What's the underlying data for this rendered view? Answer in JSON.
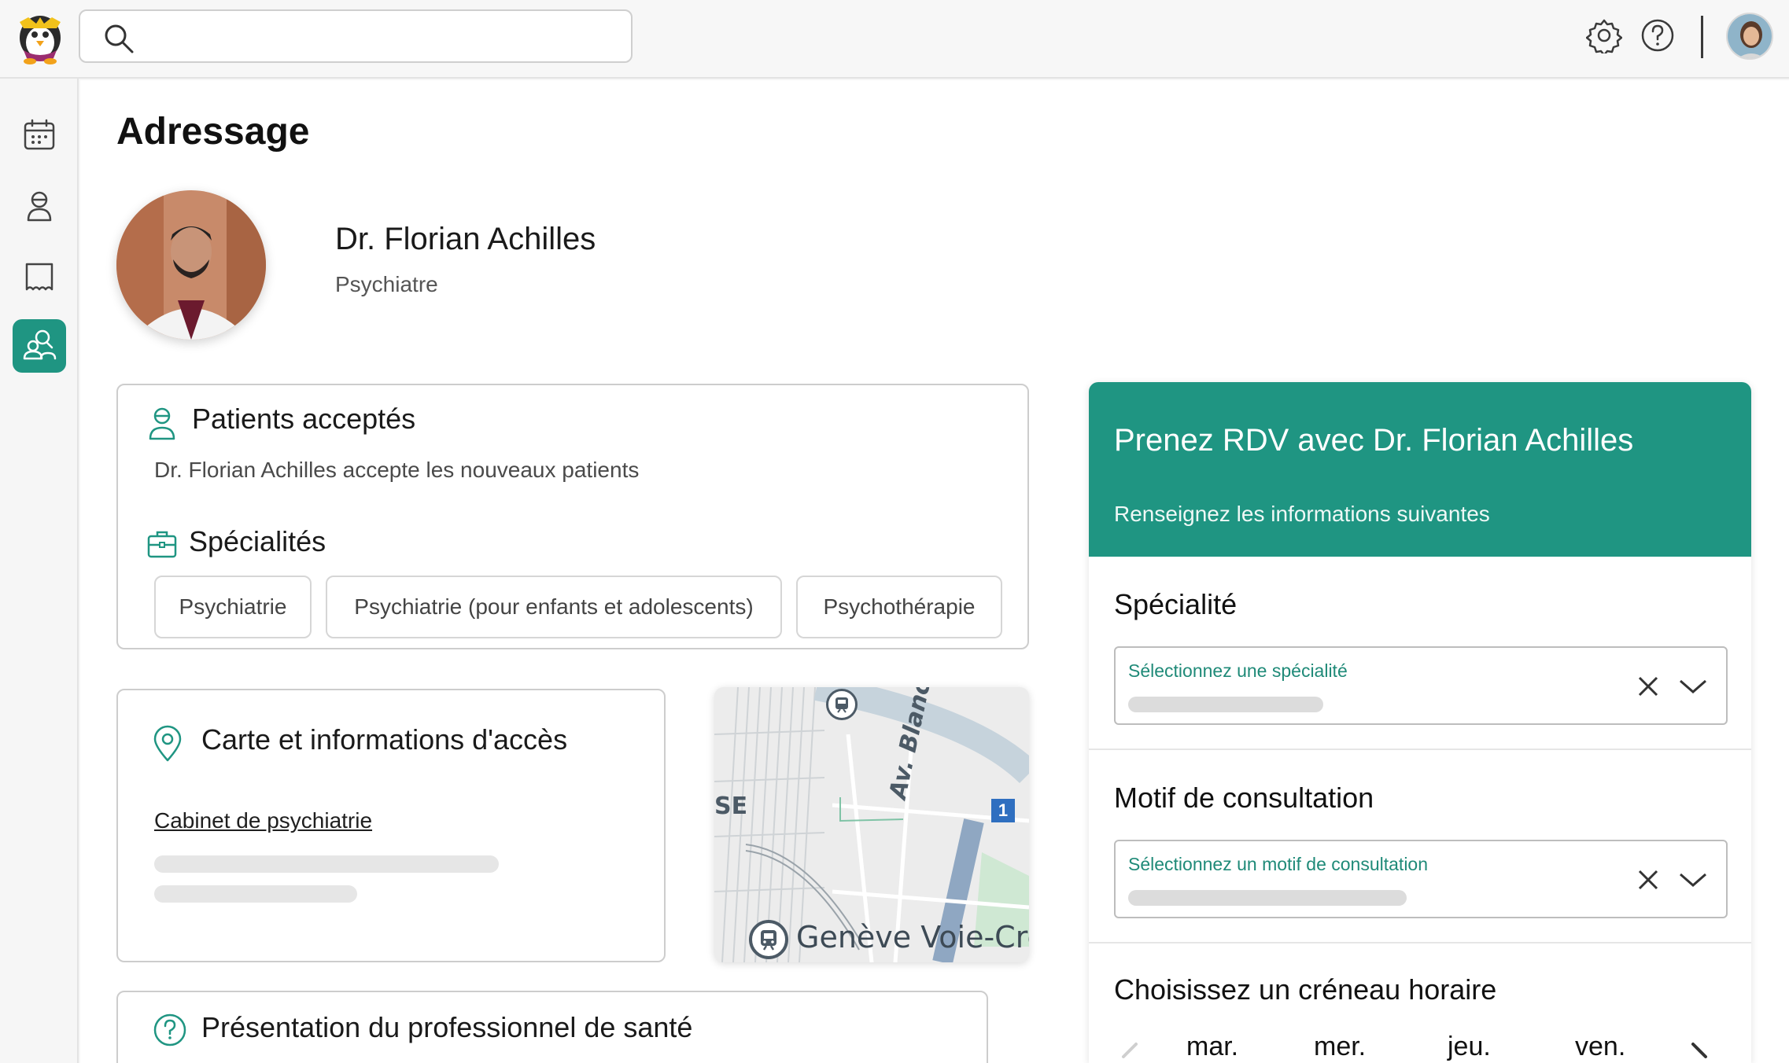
{
  "search": {
    "placeholder": ""
  },
  "page": {
    "title": "Adressage"
  },
  "doctor": {
    "name": "Dr. Florian Achilles",
    "specialty": "Psychiatre"
  },
  "patients": {
    "title": "Patients acceptés",
    "text": "Dr. Florian Achilles accepte les nouveaux patients"
  },
  "specialties": {
    "title": "Spécialités",
    "tags": [
      "Psychiatrie",
      "Psychiatrie (pour enfants et adolescents)",
      "Psychothérapie"
    ]
  },
  "access": {
    "title": "Carte et informations d'accès",
    "link": "Cabinet de psychiatrie"
  },
  "map": {
    "label_se": "SE",
    "label_street": "Av. Blanc",
    "label_station": "Genève Voie-Cre",
    "label_badge": "1"
  },
  "presentation": {
    "title": "Présentation du professionnel de santé"
  },
  "booking": {
    "title": "Prenez RDV avec Dr. Florian Achilles",
    "subtitle": "Renseignez les informations suivantes",
    "specialty_section": "Spécialité",
    "specialty_select_label": "Sélectionnez une spécialité",
    "motif_section": "Motif de consultation",
    "motif_select_label": "Sélectionnez un motif de consultation",
    "slot_section": "Choisissez un créneau horaire",
    "days": [
      "mar.",
      "mer.",
      "jeu.",
      "ven."
    ]
  },
  "colors": {
    "accent": "#1f9582",
    "accent_text": "#1f8a78"
  },
  "icons": {
    "topbar": [
      "app-logo",
      "search-icon",
      "settings-icon",
      "help-icon",
      "user-avatar"
    ],
    "sidebar": [
      "calendar-icon",
      "patient-icon",
      "inbox-icon",
      "referral-icon"
    ]
  }
}
